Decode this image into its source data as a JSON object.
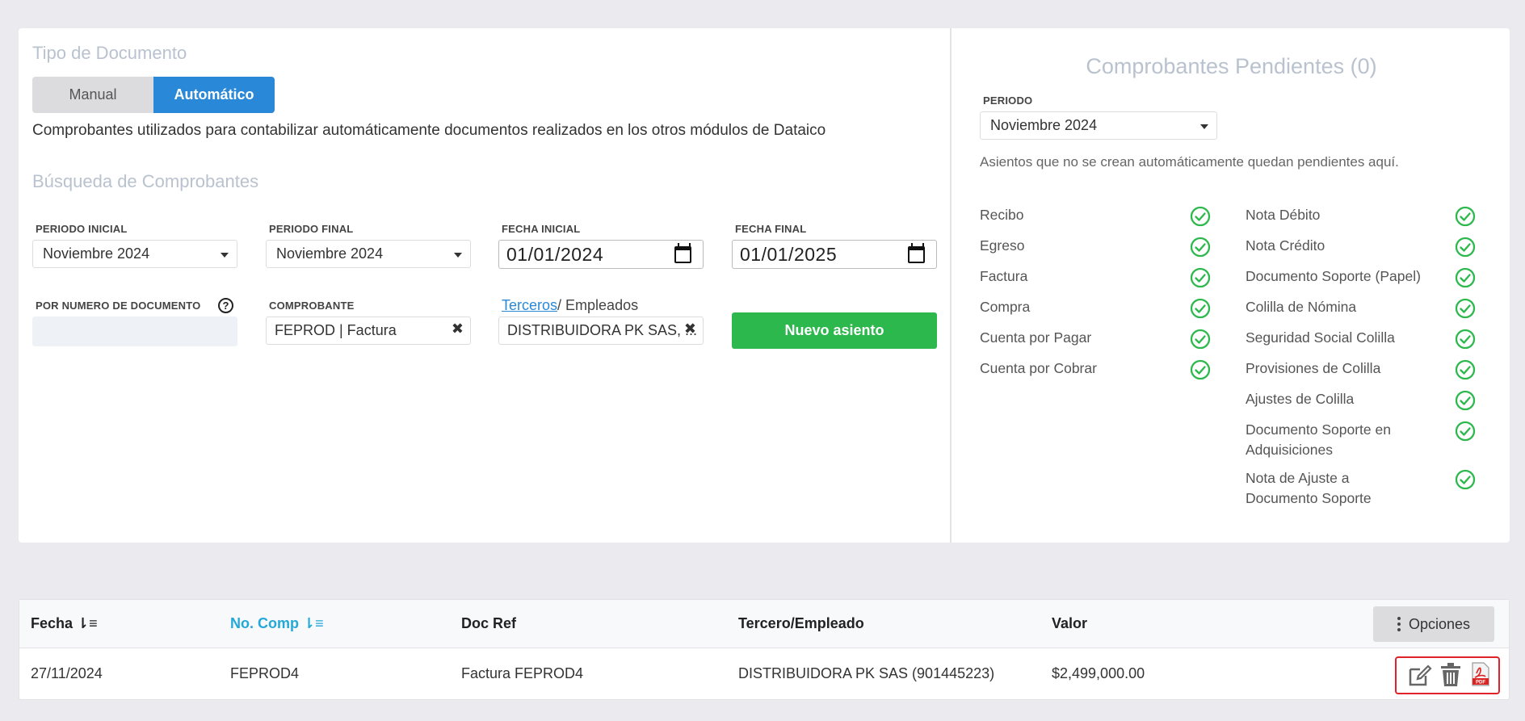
{
  "tipo": {
    "title": "Tipo de Documento",
    "manual_label": "Manual",
    "automatico_label": "Automático",
    "description": "Comprobantes utilizados para contabilizar automáticamente documentos realizados en los otros módulos de Dataico"
  },
  "busqueda": {
    "title": "Búsqueda de Comprobantes",
    "periodo_inicial_label": "PERIODO INICIAL",
    "periodo_inicial_value": "Noviembre 2024",
    "periodo_final_label": "PERIODO FINAL",
    "periodo_final_value": "Noviembre 2024",
    "fecha_inicial_label": "FECHA INICIAL",
    "fecha_inicial_value": "01/01/2024",
    "fecha_final_label": "FECHA FINAL",
    "fecha_final_value": "01/01/2025",
    "numero_doc_label": "POR NUMERO DE DOCUMENTO",
    "comprobante_label": "COMPROBANTE",
    "comprobante_value": "FEPROD | Factura",
    "terceros_link": "Terceros",
    "empleados_label": "/ Empleados",
    "tercero_value": "DISTRIBUIDORA PK SAS, ...",
    "nuevo_asiento_label": "Nuevo asiento"
  },
  "pendientes": {
    "title": "Comprobantes Pendientes (0)",
    "periodo_label": "PERIODO",
    "periodo_value": "Noviembre 2024",
    "description": "Asientos que no se crean automáticamente quedan pendientes aquí.",
    "left_items": [
      "Recibo",
      "Egreso",
      "Factura",
      "Compra",
      "Cuenta por Pagar",
      "Cuenta por Cobrar"
    ],
    "right_items": [
      "Nota Débito",
      "Nota Crédito",
      "Documento Soporte (Papel)",
      "Colilla de Nómina",
      "Seguridad Social Colilla",
      "Provisiones de Colilla",
      "Ajustes de Colilla",
      "Documento Soporte en Adquisiciones",
      "Nota de Ajuste a Documento Soporte"
    ],
    "check_color": "#2db84d"
  },
  "table": {
    "headers": [
      "Fecha",
      "No. Comp",
      "Doc Ref",
      "Tercero/Empleado",
      "Valor"
    ],
    "opciones_label": "Opciones",
    "row": [
      "27/11/2024",
      "FEPROD4",
      "Factura FEPROD4",
      "DISTRIBUIDORA PK SAS (901445223)",
      "$2,499,000.00"
    ],
    "pdf_label": "PDF"
  },
  "colors": {
    "accent": "#2a88d8",
    "success": "#2db84d",
    "highlight": "#e0232b"
  }
}
